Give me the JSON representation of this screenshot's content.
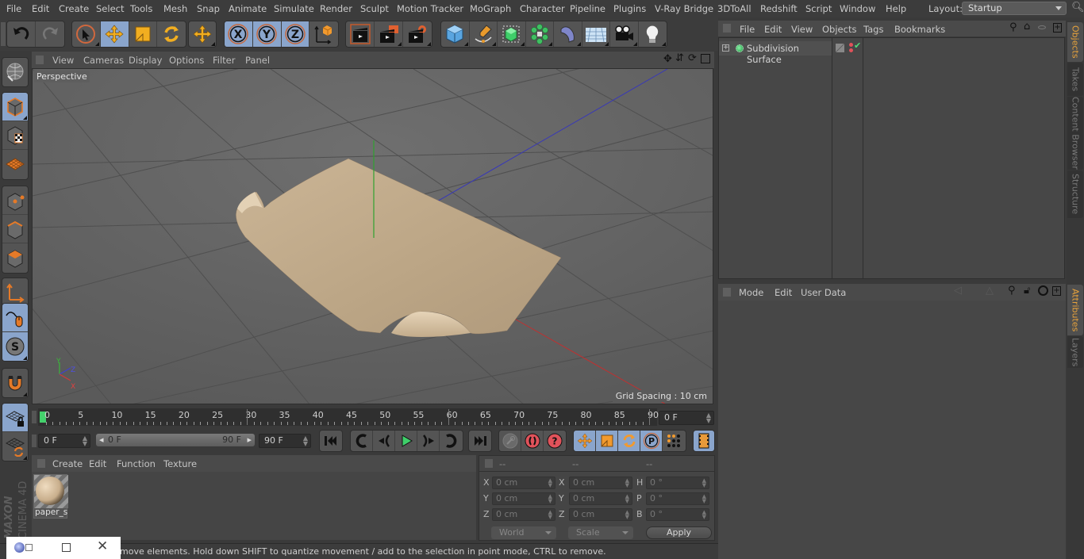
{
  "menubar": {
    "items": [
      "File",
      "Edit",
      "Create",
      "Select",
      "Tools",
      "Mesh",
      "Snap",
      "Animate",
      "Simulate",
      "Render",
      "Sculpt",
      "Motion Tracker",
      "MoGraph",
      "Character",
      "Pipeline",
      "Plugins",
      "V-Ray Bridge",
      "3DToAll",
      "Redshift",
      "Script",
      "Window",
      "Help"
    ],
    "layout_label": "Layout:",
    "layout_value": "Startup"
  },
  "toolbar": {
    "groups": [
      {
        "name": "history",
        "items": [
          "undo-icon",
          "redo-icon"
        ]
      },
      {
        "name": "tools",
        "items": [
          "live-selection-icon",
          "move-icon",
          "scale-icon",
          "rotate-icon"
        ]
      },
      {
        "name": "recent",
        "items": [
          "move-recent-icon"
        ]
      },
      {
        "name": "axes",
        "items": [
          "x-axis-lock-icon",
          "y-axis-lock-icon",
          "z-axis-lock-icon",
          "coordinate-system-icon"
        ]
      },
      {
        "name": "render",
        "items": [
          "render-view-icon",
          "render-picture-viewer-icon",
          "render-settings-icon"
        ]
      },
      {
        "name": "create",
        "items": [
          "cube-icon",
          "pen-spline-icon",
          "subdivision-surface-icon",
          "cloner-icon",
          "deformer-icon",
          "floor-icon",
          "camera-icon",
          "light-icon"
        ]
      }
    ]
  },
  "left_palette": [
    "make-editable-icon",
    "model-mode-icon",
    "texture-mode-icon",
    "workplane-mode-icon",
    "points-mode-icon",
    "edges-mode-icon",
    "polygons-mode-icon",
    "axis-mode-icon",
    "tweak-mode-icon",
    "solo-mode-icon",
    "snap-icon",
    "workplane-lock-icon",
    "workplane-align-icon"
  ],
  "viewport": {
    "menu": [
      "View",
      "Cameras",
      "Display",
      "Options",
      "Filter",
      "Panel"
    ],
    "camera_label": "Perspective",
    "grid_spacing": "Grid Spacing : 10 cm",
    "axis_labels": {
      "x": "X",
      "y": "Y",
      "z": "Z"
    },
    "nav_icons": [
      "pan-icon",
      "dolly-icon",
      "orbit-icon",
      "maximize-view-icon"
    ]
  },
  "timeline": {
    "ticks": [
      "0",
      "5",
      "10",
      "15",
      "20",
      "25",
      "30",
      "35",
      "40",
      "45",
      "50",
      "55",
      "60",
      "65",
      "70",
      "75",
      "80",
      "85",
      "90"
    ],
    "current_frame": "0 F",
    "start_frame": "0 F",
    "range_start": "0 F",
    "range_end": "90 F",
    "end_frame": "90 F"
  },
  "playback": {
    "buttons": [
      "go-to-start-icon",
      "previous-key-icon",
      "previous-frame-icon",
      "play-icon",
      "next-frame-icon",
      "next-key-icon",
      "go-to-end-icon"
    ],
    "key_buttons": [
      "record-key-disabled-icon",
      "autokey-icon",
      "keyframe-selection-icon"
    ],
    "track_buttons": [
      "position-track-icon",
      "scale-track-icon",
      "rotation-track-icon",
      "parameter-track-icon",
      "point-level-animation-icon"
    ],
    "timeline_button": "timeline-window-icon"
  },
  "material_manager": {
    "menu": [
      "Create",
      "Edit",
      "Function",
      "Texture"
    ],
    "materials": [
      {
        "name": "paper_s"
      }
    ]
  },
  "coordinates": {
    "headers": [
      "--",
      "--",
      "--"
    ],
    "rows": [
      {
        "l1": "X",
        "v1": "0 cm",
        "l2": "X",
        "v2": "0 cm",
        "l3": "H",
        "v3": "0 °"
      },
      {
        "l1": "Y",
        "v1": "0 cm",
        "l2": "Y",
        "v2": "0 cm",
        "l3": "P",
        "v3": "0 °"
      },
      {
        "l1": "Z",
        "v1": "0 cm",
        "l2": "Z",
        "v2": "0 cm",
        "l3": "B",
        "v3": "0 °"
      }
    ],
    "space": "World",
    "mode": "Scale",
    "apply": "Apply"
  },
  "status": {
    "text": "move elements. Hold down SHIFT to quantize movement / add to the selection in point mode, CTRL to remove."
  },
  "object_manager": {
    "menu": [
      "File",
      "Edit",
      "View",
      "Objects",
      "Tags",
      "Bookmarks"
    ],
    "objects": [
      {
        "name": "Subdivision Surface"
      }
    ]
  },
  "attribute_manager": {
    "menu": [
      "Mode",
      "Edit",
      "User Data"
    ]
  },
  "right_tabs": {
    "top": [
      {
        "label": "Objects",
        "active": true
      },
      {
        "label": "Takes"
      },
      {
        "label": "Content Browser"
      },
      {
        "label": "Structure"
      }
    ],
    "bottom": [
      {
        "label": "Attributes",
        "active": true
      },
      {
        "label": "Layers"
      }
    ]
  },
  "brand": {
    "logo_text_1": "MAXON",
    "logo_text_2": "CINEMA 4D"
  },
  "colors": {
    "accent": "#8aa5cc",
    "active_tab": "#e8a33c",
    "playhead": "#44d16c",
    "paper": "#c3ab8c"
  }
}
